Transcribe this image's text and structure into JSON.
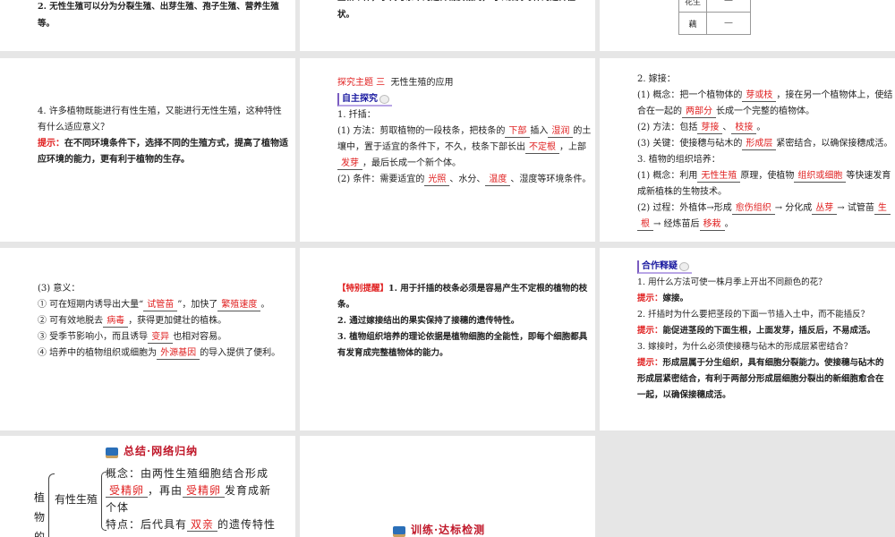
{
  "slides": {
    "s1": {
      "text": "2. 无性生殖可以分为分裂生殖、出芽生殖、孢子生殖、营养生殖等。"
    },
    "s2": {
      "text": "生新个体，子代与亲本的遗传物质相同，可以保持母体的遗传性状。"
    },
    "s3": {
      "rows": [
        "花生",
        "藕"
      ]
    },
    "s4": {
      "question": "4. 许多植物既能进行有性生殖，又能进行无性生殖，这种特性有什么适应意义？",
      "hint_label": "提示：",
      "hint": "在不同环境条件下，选择不同的生殖方式，提高了植物适应环境的能力，更有利于植物的生存。"
    },
    "s5": {
      "topic_label": "探究主题 三",
      "topic": "无性生殖的应用",
      "tag": "自主探究",
      "lines": [
        [
          {
            "t": "1. 扦插："
          }
        ],
        [
          {
            "t": "(1) 方法：剪取植物的一段枝条，把枝条的"
          },
          {
            "b": "下部"
          },
          {
            "t": "插入"
          },
          {
            "b": "湿润"
          },
          {
            "t": "的土"
          }
        ],
        [
          {
            "t": "壤中，置于适宜的条件下，不久，枝条下部长出"
          },
          {
            "b": "不定根"
          },
          {
            "t": "，上部"
          }
        ],
        [
          {
            "b": "发芽"
          },
          {
            "t": "，最后长成一个新个体。"
          }
        ],
        [
          {
            "t": "(2) 条件：需要适宜的"
          },
          {
            "b": "光照"
          },
          {
            "t": "、水分、"
          },
          {
            "b": "温度"
          },
          {
            "t": "、湿度等环境条件。"
          }
        ]
      ]
    },
    "s6": {
      "lines": [
        [
          {
            "t": "2. 嫁接："
          }
        ],
        [
          {
            "t": "(1) 概念：把一个植物体的"
          },
          {
            "b": "芽或枝"
          },
          {
            "t": "，接在另一个植物体上，使结"
          }
        ],
        [
          {
            "t": "合在一起的"
          },
          {
            "b": "两部分"
          },
          {
            "t": "长成一个完整的植物体。"
          }
        ],
        [
          {
            "t": "(2) 方法：包括"
          },
          {
            "b": "芽接"
          },
          {
            "t": "、"
          },
          {
            "b": "枝接"
          },
          {
            "t": "。"
          }
        ],
        [
          {
            "t": "(3) 关键：使接穗与砧木的"
          },
          {
            "b": "形成层"
          },
          {
            "t": "紧密结合，以确保接穗成活。"
          }
        ],
        [
          {
            "t": "3. 植物的组织培养："
          }
        ],
        [
          {
            "t": "(1) 概念：利用"
          },
          {
            "b": "无性生殖"
          },
          {
            "t": "原理，使植物"
          },
          {
            "b": "组织或细胞"
          },
          {
            "t": "等快速发育"
          }
        ],
        [
          {
            "t": "成新植株的生物技术。"
          }
        ],
        [
          {
            "t": "(2) 过程：外植体→形成"
          },
          {
            "b": "愈伤组织"
          },
          {
            "t": "→ 分化成"
          },
          {
            "b": "丛芽"
          },
          {
            "t": "→ 试管苗"
          },
          {
            "b": "生"
          }
        ],
        [
          {
            "b": "根"
          },
          {
            "t": "→ 经炼苗后"
          },
          {
            "b": "移栽"
          },
          {
            "t": "。"
          }
        ]
      ]
    },
    "s7": {
      "lines": [
        [
          {
            "t": "(3) 意义："
          }
        ],
        [
          {
            "t": "① 可在短期内诱导出大量“"
          },
          {
            "b": "试管苗"
          },
          {
            "t": "”，加快了"
          },
          {
            "b": "繁殖速度"
          },
          {
            "t": "。"
          }
        ],
        [
          {
            "t": "② 可有效地脱去"
          },
          {
            "b": "病毒"
          },
          {
            "t": "，获得更加健壮的植株。"
          }
        ],
        [
          {
            "t": "③ 受季节影响小，而且诱导"
          },
          {
            "b": "变异"
          },
          {
            "t": "也相对容易。"
          }
        ],
        [
          {
            "t": "④ 培养中的植物组织或细胞为"
          },
          {
            "b": "外源基因"
          },
          {
            "t": "的导入提供了便利。"
          }
        ]
      ]
    },
    "s8": {
      "label": "【特别提醒】",
      "items": [
        "1. 用于扦插的枝条必须是容易产生不定根的植物的枝条。",
        "2. 通过嫁接结出的果实保持了接穗的遗传特性。",
        "3. 植物组织培养的理论依据是植物细胞的全能性，即每个细胞都具有发育成完整植物体的能力。"
      ]
    },
    "s9": {
      "tag": "合作释疑",
      "qa": [
        {
          "q": "1. 用什么方法可使一株月季上开出不同颜色的花？",
          "a": "嫁接。"
        },
        {
          "q": "2. 扦插时为什么要把茎段的下面一节插入土中，而不能插反？",
          "a": "能促进茎段的下面生根，上面发芽，插反后，不易成活。"
        },
        {
          "q": "3. 嫁接时，为什么必须使接穗与砧木的形成层紧密结合？",
          "a": "形成层属于分生组织，具有细胞分裂能力。使接穗与砧木的形成层紧密结合，有利于两部分形成层细胞分裂出的新细胞愈合在一起，以确保接穗成活。"
        }
      ],
      "hint_label": "提示："
    },
    "s10": {
      "banner": "总结·网络归纳",
      "root": "植物的",
      "branch": "有性生殖",
      "concept_label": "概念：",
      "concept_a": "由两性生殖细胞结合形成",
      "b1": "受精卵",
      "concept_b": "，再由",
      "b2": "受精卵",
      "concept_c": "发育成新个体",
      "feature_label": "特点：",
      "feature_a": "后代具有",
      "b3": "双亲",
      "feature_b": "的遗传特性"
    },
    "s11": {
      "banner": "训练·达标检测"
    }
  }
}
